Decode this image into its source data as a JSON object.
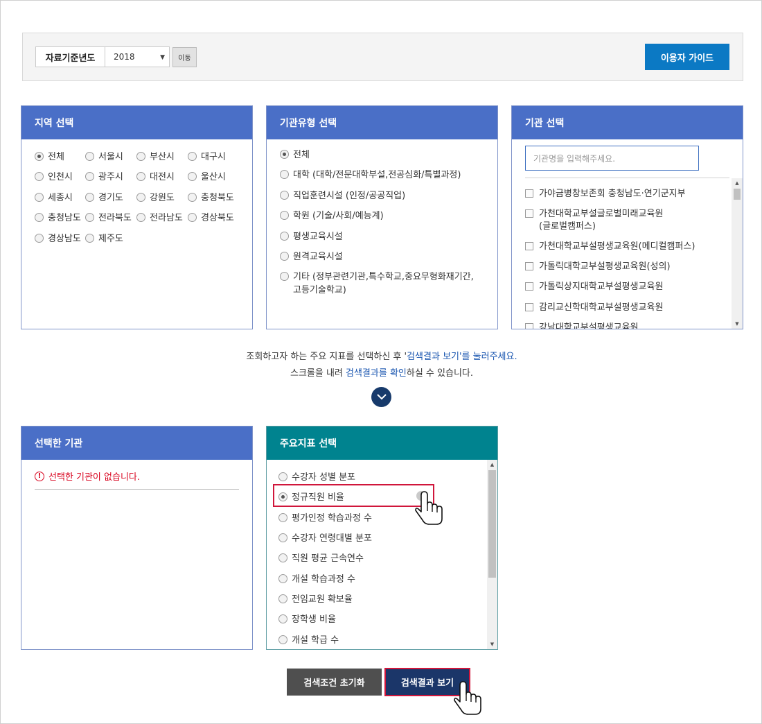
{
  "filter": {
    "year_label": "자료기준년도",
    "year_value": "2018",
    "move_label": "이동",
    "guide_label": "이용자 가이드"
  },
  "region_panel": {
    "title": "지역 선택",
    "items": [
      "전체",
      "서울시",
      "부산시",
      "대구시",
      "인천시",
      "광주시",
      "대전시",
      "울산시",
      "세종시",
      "경기도",
      "강원도",
      "충청북도",
      "충청남도",
      "전라북도",
      "전라남도",
      "경상북도",
      "경상남도",
      "제주도"
    ],
    "selected": "전체"
  },
  "type_panel": {
    "title": "기관유형 선택",
    "items": [
      {
        "line1": "전체",
        "line2": ""
      },
      {
        "line1": "대학 (대학/전문대학부설,전공심화/특별과정)",
        "line2": ""
      },
      {
        "line1": "직업훈련시설 (인정/공공직업)",
        "line2": ""
      },
      {
        "line1": "학원 (기술/사회/예능계)",
        "line2": ""
      },
      {
        "line1": "평생교육시설",
        "line2": ""
      },
      {
        "line1": "원격교육시설",
        "line2": ""
      },
      {
        "line1": "기타 (정부관련기관,특수학교,중요무형화재기간,",
        "line2": "고등기술학교)"
      }
    ],
    "selected": "전체"
  },
  "inst_panel": {
    "title": "기관 선택",
    "search_placeholder": "기관명을 입력해주세요.",
    "items": [
      {
        "line1": "가야금병창보존회 충청남도·연기군지부",
        "line2": ""
      },
      {
        "line1": "가천대학교부설글로벌미래교육원",
        "line2": "(글로벌캠퍼스)"
      },
      {
        "line1": "가천대학교부설평생교육원(메디컬캠퍼스)",
        "line2": ""
      },
      {
        "line1": "가톨릭대학교부설평생교육원(성의)",
        "line2": ""
      },
      {
        "line1": "가톨릭상지대학교부설평생교육원",
        "line2": ""
      },
      {
        "line1": "감리교신학대학교부설평생교육원",
        "line2": ""
      },
      {
        "line1": "강남대학교부설평생교육원",
        "line2": ""
      }
    ]
  },
  "info": {
    "line1_a": "조회하고자 하는 주요 지표를 선택하신 후 '",
    "line1_link": "검색결과 보기'를 눌러주세요.",
    "line2_a": "스크롤을 내려 ",
    "line2_link": "검색결과를 확인",
    "line2_b": "하실 수 있습니다."
  },
  "selected_panel": {
    "title": "선택한 기관",
    "empty_text": "선택한 기관이 없습니다."
  },
  "indicator_panel": {
    "title": "주요지표 선택",
    "items": [
      "수강자 성별 분포",
      "정규직원 비율",
      "평가인정 학습과정 수",
      "수강자 연령대별 분포",
      "직원 평균 근속연수",
      "개설 학습과정 수",
      "전임교원 확보율",
      "장학생 비율",
      "개설 학급 수"
    ],
    "selected": "정규직원 비율"
  },
  "actions": {
    "reset_label": "검색조건 초기화",
    "search_label": "검색결과 보기"
  }
}
